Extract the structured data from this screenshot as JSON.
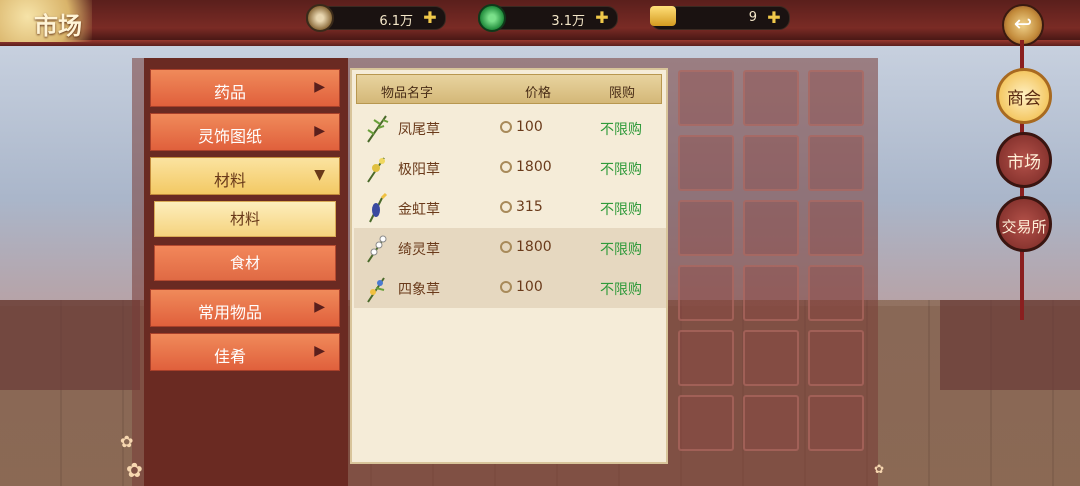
{
  "header": {
    "title": "市场",
    "resources": [
      {
        "name": "copper-coin",
        "value": "6.1万"
      },
      {
        "name": "jade-coin",
        "value": "3.1万"
      },
      {
        "name": "gold-ingot",
        "value": "9"
      }
    ]
  },
  "categories": [
    {
      "label": "药品",
      "expanded": false
    },
    {
      "label": "灵饰图纸",
      "expanded": false
    },
    {
      "label": "材料",
      "expanded": true
    },
    {
      "label": "常用物品",
      "expanded": false
    },
    {
      "label": "佳肴",
      "expanded": false
    }
  ],
  "subcategories": [
    {
      "label": "材料",
      "selected": true
    },
    {
      "label": "食材",
      "selected": false
    }
  ],
  "table": {
    "headers": {
      "name": "物品名字",
      "price": "价格",
      "limit": "限购"
    },
    "rows": [
      {
        "name": "凤尾草",
        "price": "100",
        "limit": "不限购"
      },
      {
        "name": "极阳草",
        "price": "1800",
        "limit": "不限购"
      },
      {
        "name": "金虹草",
        "price": "315",
        "limit": "不限购"
      },
      {
        "name": "绮灵草",
        "price": "1800",
        "limit": "不限购"
      },
      {
        "name": "四象草",
        "price": "100",
        "limit": "不限购"
      }
    ]
  },
  "side_tabs": [
    {
      "label": "商会",
      "active": true
    },
    {
      "label": "市场",
      "active": false
    },
    {
      "label": "交易所",
      "active": false
    }
  ],
  "colors": {
    "limit_text": "#2f9a3a",
    "accent_gold": "#f4c864",
    "tab_red": "#e0603c"
  }
}
